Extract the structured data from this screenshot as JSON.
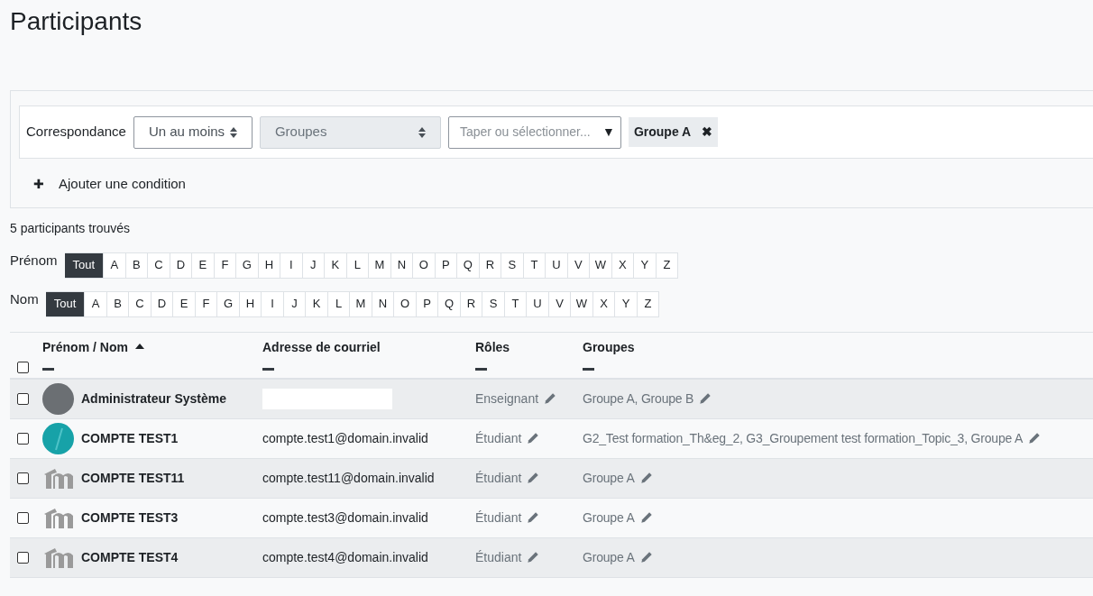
{
  "title": "Participants",
  "filter": {
    "match_label": "Correspondance",
    "match_value": "Un au moins",
    "type_value": "Groupes",
    "type_disabled": true,
    "value_placeholder": "Taper ou sélectionner...",
    "value_caret": "▼",
    "selected_tags": [
      {
        "label": "Groupe A",
        "remove": "✖"
      }
    ],
    "add_condition": {
      "icon": "✚",
      "label": "Ajouter une condition"
    }
  },
  "count": "5 participants trouvés",
  "initials_bars": [
    {
      "label": "Prénom",
      "letters": [
        {
          "text": "Tout",
          "selected": true
        },
        {
          "text": "A",
          "selected": false
        },
        {
          "text": "B",
          "selected": false
        },
        {
          "text": "C",
          "selected": false
        },
        {
          "text": "D",
          "selected": false
        },
        {
          "text": "E",
          "selected": false
        },
        {
          "text": "F",
          "selected": false
        },
        {
          "text": "G",
          "selected": false
        },
        {
          "text": "H",
          "selected": false
        },
        {
          "text": "I",
          "selected": false
        },
        {
          "text": "J",
          "selected": false
        },
        {
          "text": "K",
          "selected": false
        },
        {
          "text": "L",
          "selected": false
        },
        {
          "text": "M",
          "selected": false
        },
        {
          "text": "N",
          "selected": false
        },
        {
          "text": "O",
          "selected": false
        },
        {
          "text": "P",
          "selected": false
        },
        {
          "text": "Q",
          "selected": false
        },
        {
          "text": "R",
          "selected": false
        },
        {
          "text": "S",
          "selected": false
        },
        {
          "text": "T",
          "selected": false
        },
        {
          "text": "U",
          "selected": false
        },
        {
          "text": "V",
          "selected": false
        },
        {
          "text": "W",
          "selected": false
        },
        {
          "text": "X",
          "selected": false
        },
        {
          "text": "Y",
          "selected": false
        },
        {
          "text": "Z",
          "selected": false
        }
      ]
    },
    {
      "label": "Nom",
      "letters": [
        {
          "text": "Tout",
          "selected": true
        },
        {
          "text": "A",
          "selected": false
        },
        {
          "text": "B",
          "selected": false
        },
        {
          "text": "C",
          "selected": false
        },
        {
          "text": "D",
          "selected": false
        },
        {
          "text": "E",
          "selected": false
        },
        {
          "text": "F",
          "selected": false
        },
        {
          "text": "G",
          "selected": false
        },
        {
          "text": "H",
          "selected": false
        },
        {
          "text": "I",
          "selected": false
        },
        {
          "text": "J",
          "selected": false
        },
        {
          "text": "K",
          "selected": false
        },
        {
          "text": "L",
          "selected": false
        },
        {
          "text": "M",
          "selected": false
        },
        {
          "text": "N",
          "selected": false
        },
        {
          "text": "O",
          "selected": false
        },
        {
          "text": "P",
          "selected": false
        },
        {
          "text": "Q",
          "selected": false
        },
        {
          "text": "R",
          "selected": false
        },
        {
          "text": "S",
          "selected": false
        },
        {
          "text": "T",
          "selected": false
        },
        {
          "text": "U",
          "selected": false
        },
        {
          "text": "V",
          "selected": false
        },
        {
          "text": "W",
          "selected": false
        },
        {
          "text": "X",
          "selected": false
        },
        {
          "text": "Y",
          "selected": false
        },
        {
          "text": "Z",
          "selected": false
        }
      ]
    }
  ],
  "table": {
    "select_all_checked": false,
    "columns": [
      {
        "label": "Prénom / Nom",
        "sorted": true
      },
      {
        "label": "Adresse de courriel",
        "sorted": false
      },
      {
        "label": "Rôles",
        "sorted": false
      },
      {
        "label": "Groupes",
        "sorted": false
      }
    ],
    "rows": [
      {
        "checked": false,
        "kind": "photo",
        "name": "Administrateur Système",
        "email": null,
        "role": "Enseignant",
        "groups": "Groupe A, Groupe B"
      },
      {
        "checked": false,
        "kind": "teal",
        "name": "COMPTE TEST1",
        "email": "compte.test1@domain.invalid",
        "role": "Étudiant",
        "groups": "G2_Test formation_Th&eg_2, G3_Groupement test formation_Topic_3, Groupe A"
      },
      {
        "checked": false,
        "kind": "default",
        "name": "COMPTE TEST11",
        "email": "compte.test11@domain.invalid",
        "role": "Étudiant",
        "groups": "Groupe A"
      },
      {
        "checked": false,
        "kind": "default",
        "name": "COMPTE TEST3",
        "email": "compte.test3@domain.invalid",
        "role": "Étudiant",
        "groups": "Groupe A"
      },
      {
        "checked": false,
        "kind": "default",
        "name": "COMPTE TEST4",
        "email": "compte.test4@domain.invalid",
        "role": "Étudiant",
        "groups": "Groupe A"
      }
    ]
  }
}
